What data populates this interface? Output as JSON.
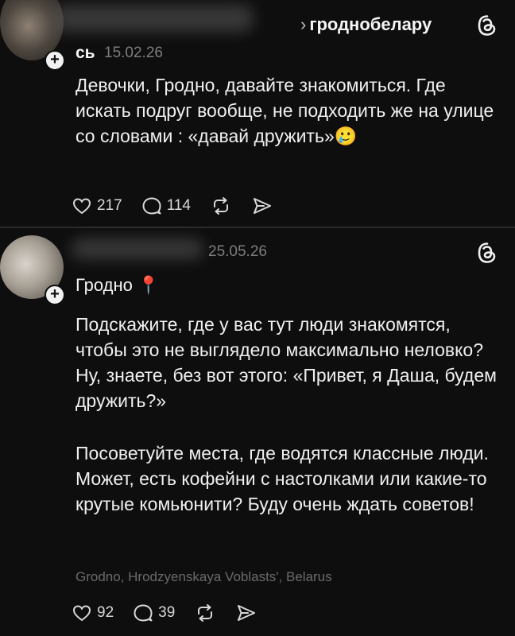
{
  "post1": {
    "breadcrumb_chevron": "›",
    "community": "гроднобелару",
    "author_suffix": "сь",
    "date": "15.02.26",
    "text": "Девочки, Гродно, давайте знакомиться. Где искать подруг вообще, не подходить же на улице со словами : «давай дружить»🥲",
    "likes": "217",
    "comments": "114"
  },
  "post2": {
    "date": "25.05.26",
    "tag": "Гродно 📍",
    "paragraphs": [
      "Подскажите, где у вас тут люди знакомятся, чтобы это не выглядело максимально неловко? Ну, знаете, без вот этого: «Привет, я Даша, будем дружить?»",
      "Посоветуйте места, где водятся классные люди. Может, есть кофейни с настолками или какие-то крутые комьюнити? Буду очень ждать советов!"
    ],
    "location": "Grodno, Hrodzyenskaya Voblasts', Belarus",
    "likes": "92",
    "comments": "39"
  },
  "icons": {
    "plus": "+",
    "heart": "heart-icon",
    "comment": "comment-icon",
    "repost": "repost-icon",
    "send": "send-icon",
    "threads": "threads-logo-icon"
  }
}
